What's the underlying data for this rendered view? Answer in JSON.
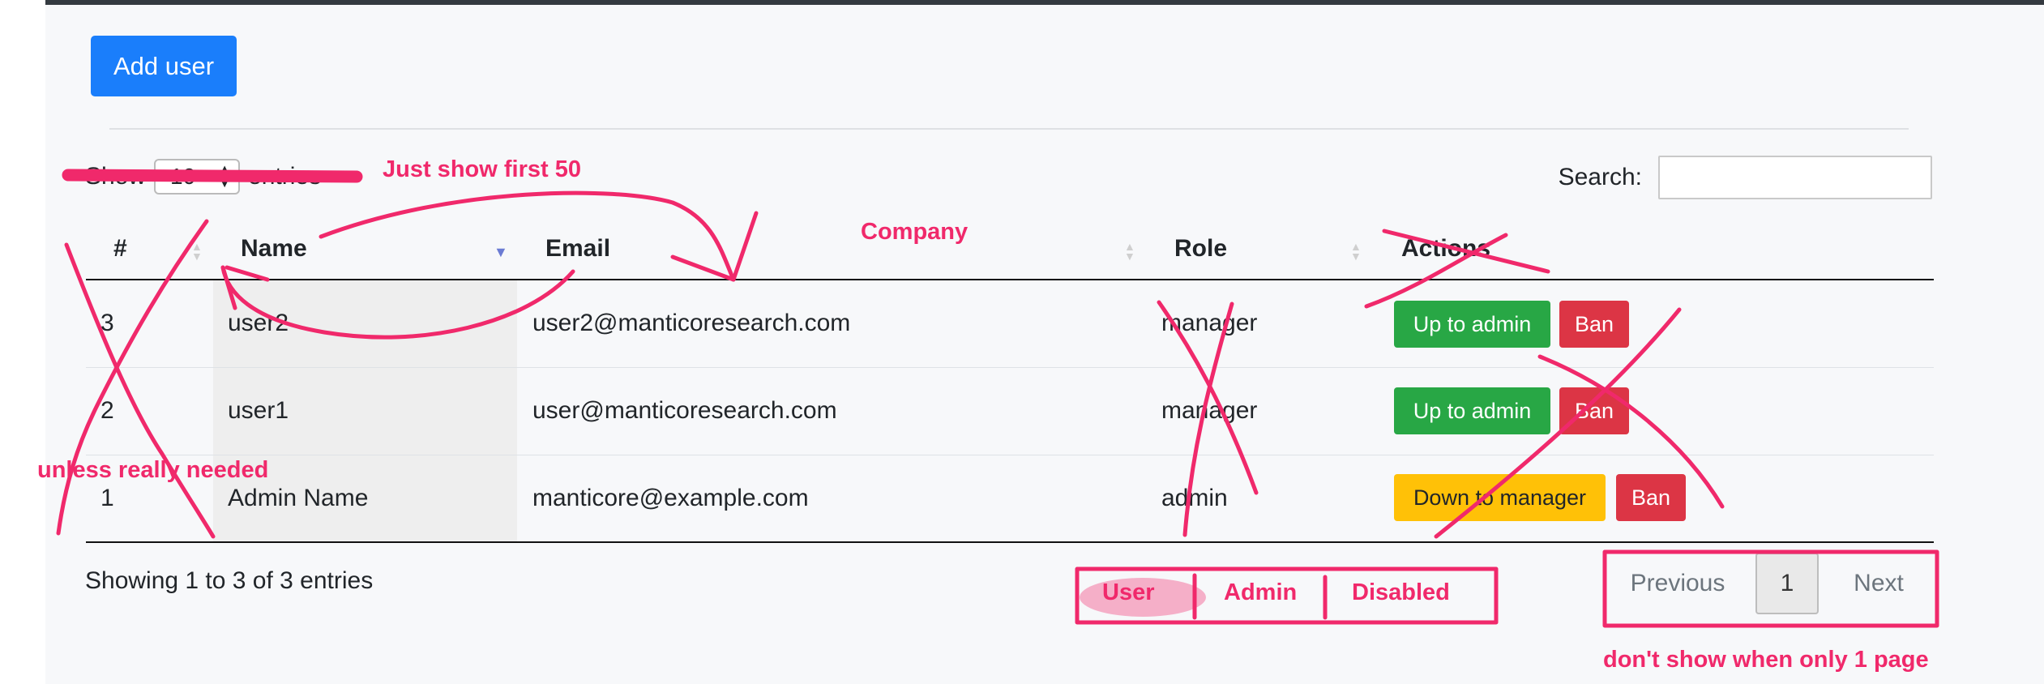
{
  "toolbar": {
    "add_user_label": "Add user"
  },
  "length_menu": {
    "prefix": "Show",
    "value": "10",
    "suffix": "entries"
  },
  "search": {
    "label": "Search:",
    "value": ""
  },
  "table": {
    "columns": [
      "#",
      "Name",
      "Email",
      "Role",
      "Actions"
    ],
    "rows": [
      {
        "id": "3",
        "name": "user2",
        "email": "user2@manticoresearch.com",
        "role": "manager",
        "actions": [
          "Up to admin",
          "Ban"
        ]
      },
      {
        "id": "2",
        "name": "user1",
        "email": "user@manticoresearch.com",
        "role": "manager",
        "actions": [
          "Up to admin",
          "Ban"
        ]
      },
      {
        "id": "1",
        "name": "Admin Name",
        "email": "manticore@example.com",
        "role": "admin",
        "actions": [
          "Down to manager",
          "Ban"
        ]
      }
    ]
  },
  "footer": {
    "info": "Showing 1 to 3 of 3 entries"
  },
  "pagination": {
    "previous": "Previous",
    "current": "1",
    "next": "Next"
  },
  "annotations": {
    "just_show": "Just show first 50",
    "company": "Company",
    "unless": "unless really needed",
    "filter_user": "User",
    "filter_admin": "Admin",
    "filter_disabled": "Disabled",
    "dont_show": "don't show when only 1 page"
  },
  "colors": {
    "primary": "#1a7efb",
    "success": "#28a745",
    "danger": "#dc3545",
    "warning": "#ffc107",
    "annotation": "#f0296b"
  }
}
